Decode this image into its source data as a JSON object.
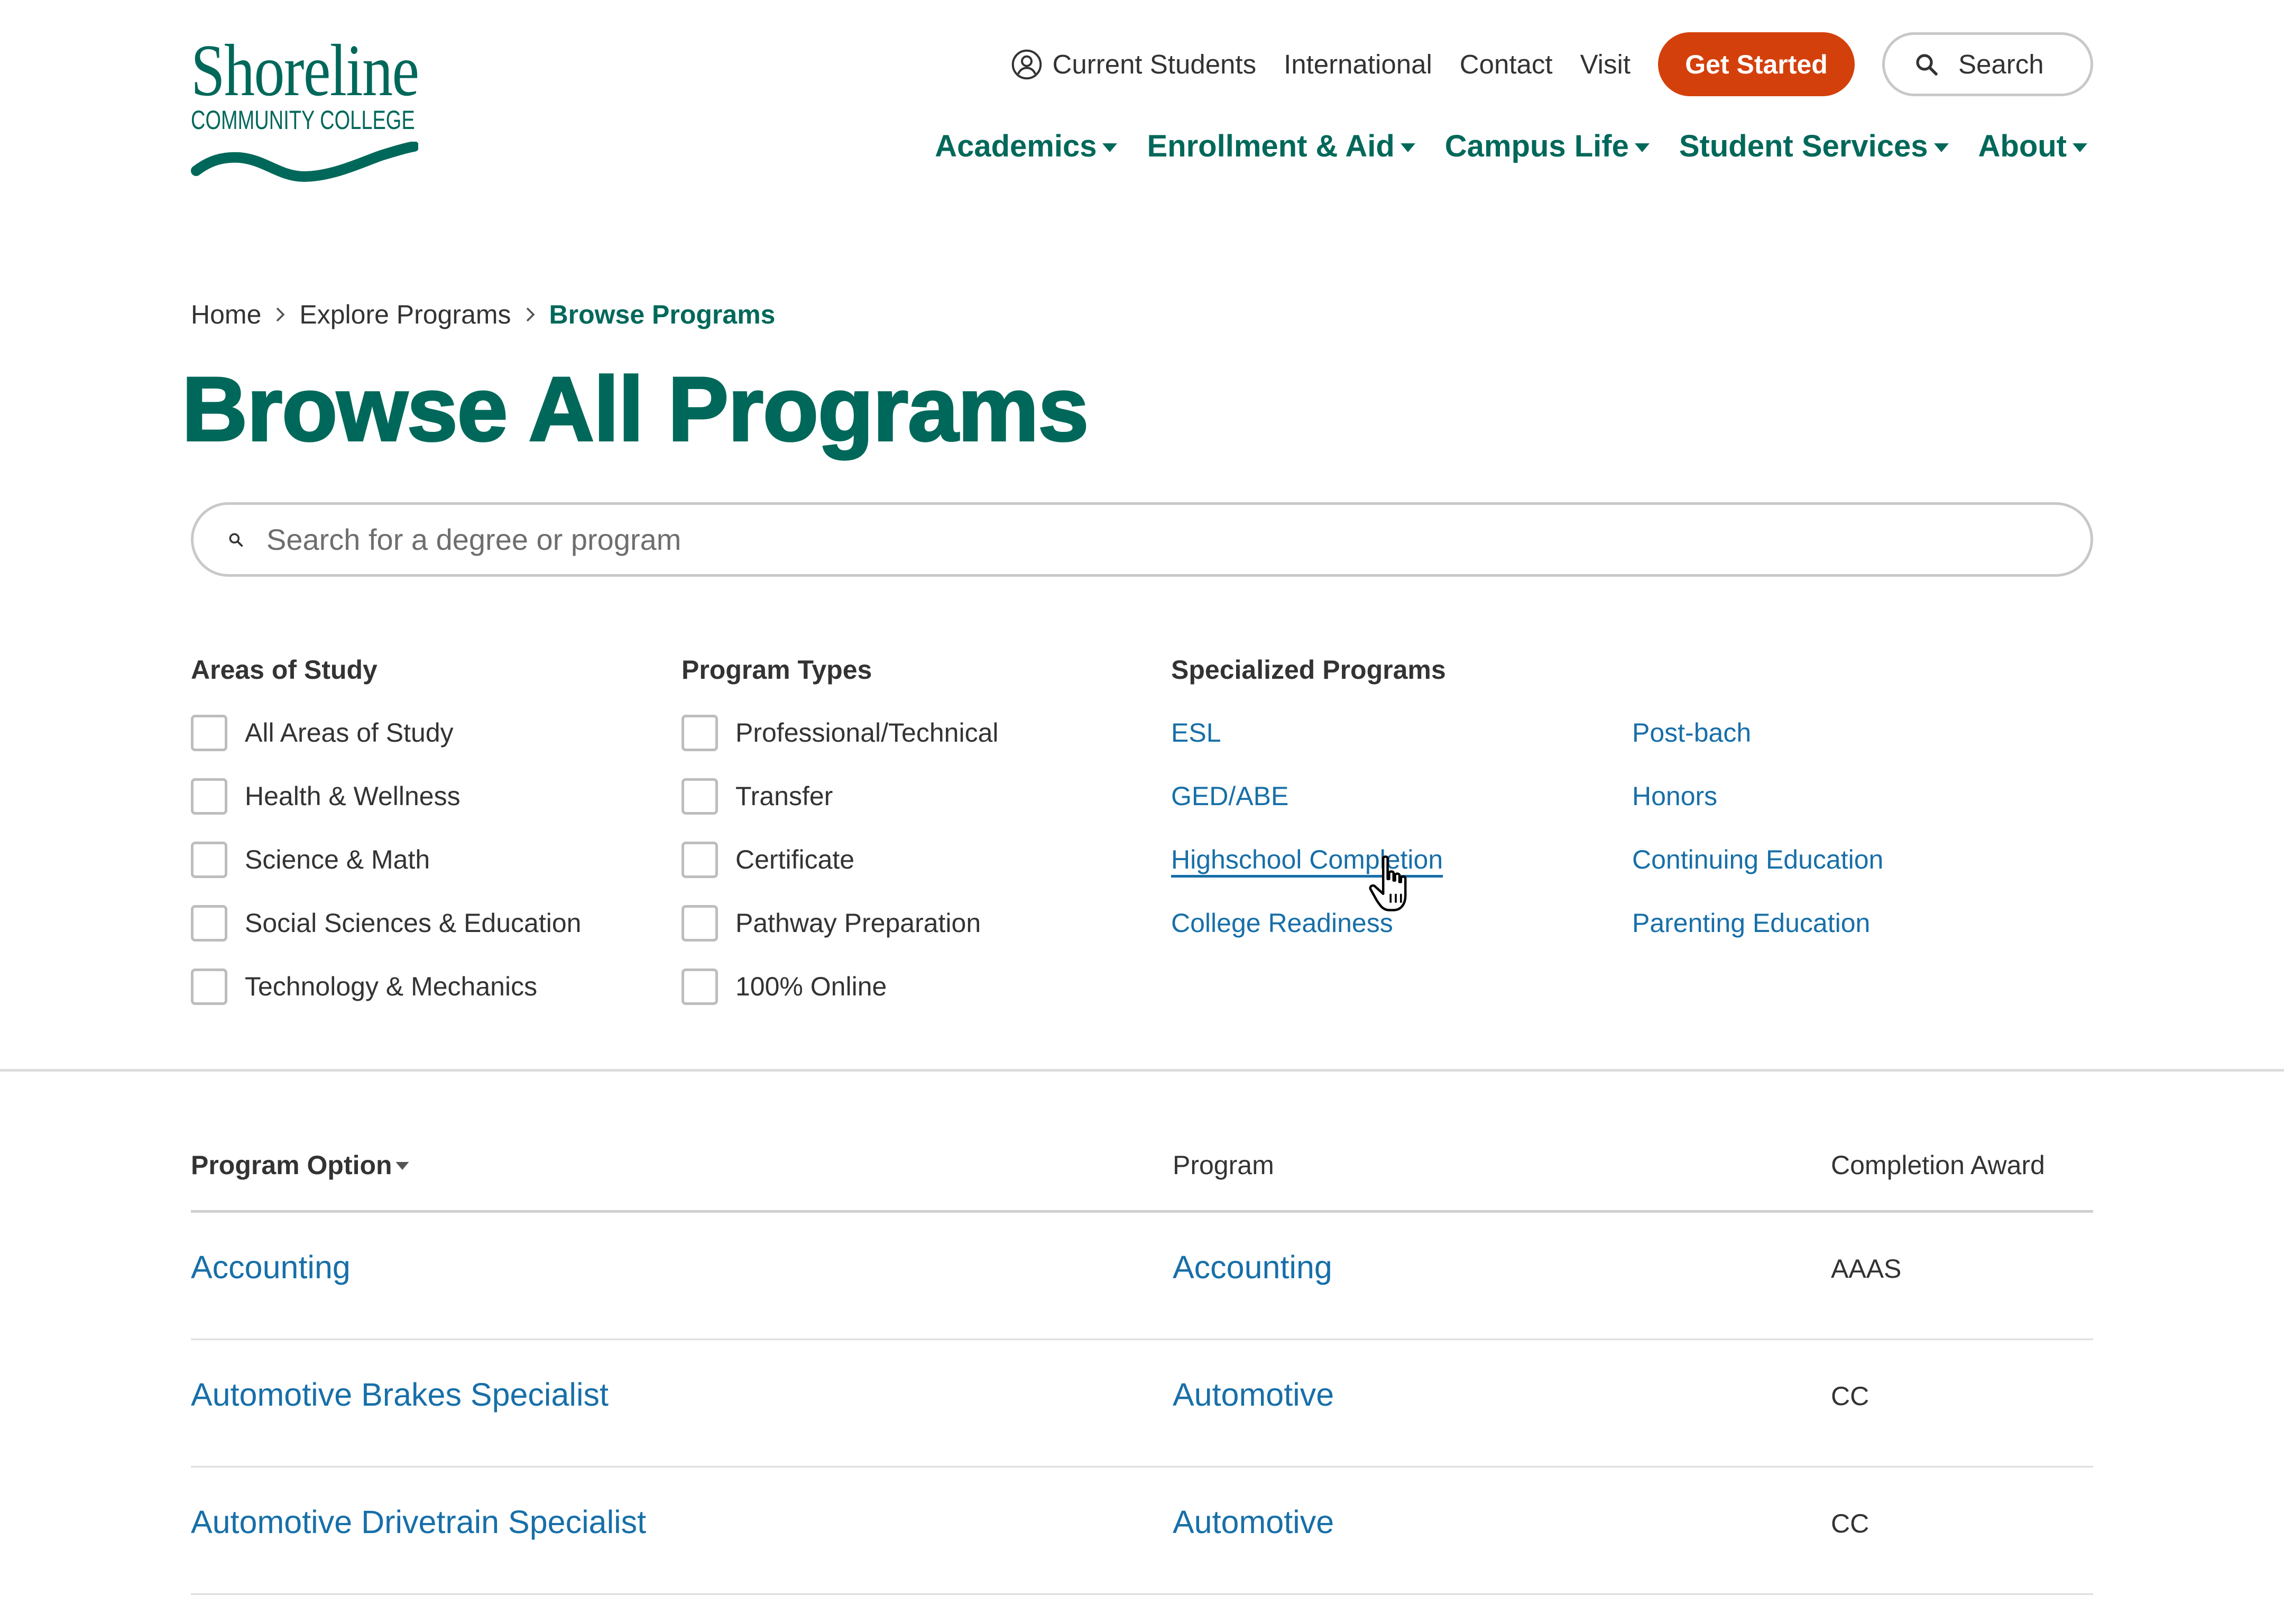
{
  "logo": {
    "name": "Shoreline",
    "subtitle": "COMMUNITY COLLEGE"
  },
  "utility_nav": {
    "items": [
      {
        "label": "Current Students",
        "icon": "user-circle-icon"
      },
      {
        "label": "International"
      },
      {
        "label": "Contact"
      },
      {
        "label": "Visit"
      }
    ],
    "get_started_label": "Get Started",
    "search_label": "Search",
    "search_icon": "search-icon"
  },
  "main_nav": [
    {
      "label": "Academics",
      "icon": "caret-down-icon"
    },
    {
      "label": "Enrollment & Aid",
      "icon": "caret-down-icon"
    },
    {
      "label": "Campus Life",
      "icon": "caret-down-icon"
    },
    {
      "label": "Student Services",
      "icon": "caret-down-icon"
    },
    {
      "label": "About",
      "icon": "caret-down-icon"
    }
  ],
  "breadcrumb": [
    {
      "label": "Home"
    },
    {
      "label": "Explore Programs"
    },
    {
      "label": "Browse Programs",
      "current": true
    }
  ],
  "page_title": "Browse All Programs",
  "program_search": {
    "placeholder": "Search for a degree or program",
    "value": "",
    "icon": "search-icon"
  },
  "filters": {
    "areas_of_study": {
      "heading": "Areas of Study",
      "options": [
        {
          "label": "All Areas of Study",
          "checked": false
        },
        {
          "label": "Health & Wellness",
          "checked": false
        },
        {
          "label": "Science & Math",
          "checked": false
        },
        {
          "label": "Social Sciences & Education",
          "checked": false
        },
        {
          "label": "Technology & Mechanics",
          "checked": false
        }
      ]
    },
    "program_types": {
      "heading": "Program Types",
      "options": [
        {
          "label": "Professional/Technical",
          "checked": false
        },
        {
          "label": "Transfer",
          "checked": false
        },
        {
          "label": "Certificate",
          "checked": false
        },
        {
          "label": "Pathway Preparation",
          "checked": false
        },
        {
          "label": "100% Online",
          "checked": false
        }
      ]
    },
    "specialized_programs": {
      "heading": "Specialized Programs",
      "columns": [
        [
          {
            "label": "ESL"
          },
          {
            "label": "GED/ABE"
          },
          {
            "label": "Highschool Completion",
            "hovered": true
          },
          {
            "label": "College Readiness"
          }
        ],
        [
          {
            "label": "Post-bach"
          },
          {
            "label": "Honors"
          },
          {
            "label": "Continuing Education"
          },
          {
            "label": "Parenting Education"
          }
        ]
      ]
    }
  },
  "table": {
    "columns": [
      {
        "label": "Program Option",
        "sort_icon": "caret-down-icon"
      },
      {
        "label": "Program"
      },
      {
        "label": "Completion Award"
      }
    ],
    "rows": [
      {
        "program_option": "Accounting",
        "program": "Accounting",
        "completion_award": "AAAS"
      },
      {
        "program_option": "Automotive Brakes Specialist",
        "program": "Automotive",
        "completion_award": "CC"
      },
      {
        "program_option": "Automotive Drivetrain Specialist",
        "program": "Automotive",
        "completion_award": "CC"
      }
    ]
  },
  "cursor": {
    "icon": "pointer-hand-icon"
  },
  "colors": {
    "brand_green": "#00685a",
    "accent_orange": "#d4400b",
    "link_blue": "#176fa8",
    "text": "#333333",
    "border": "#c8c8c8"
  }
}
